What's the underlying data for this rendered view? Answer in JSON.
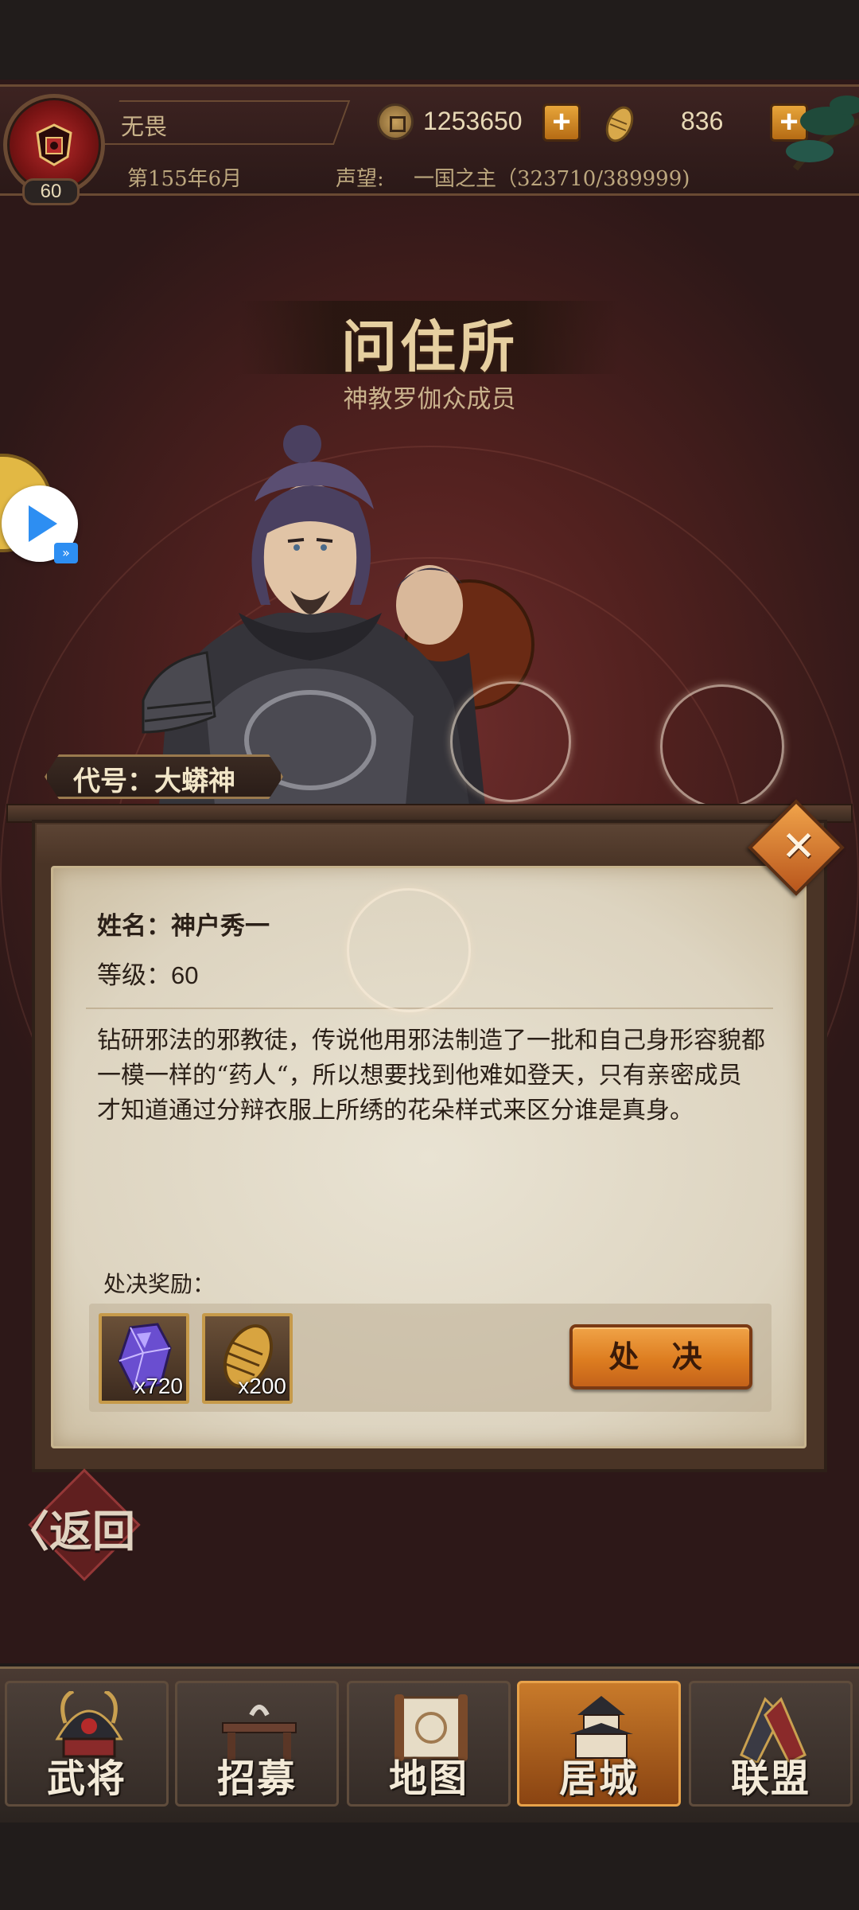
{
  "header": {
    "player_name": "无畏",
    "player_level": "60",
    "coins": "1253650",
    "ingots": "836",
    "date": "第155年6月",
    "prestige_label": "声望:",
    "prestige_value": "一国之主（323710/389999)"
  },
  "page": {
    "title": "问住所",
    "subtitle": "神教罗伽众成员"
  },
  "character": {
    "code_name": "代号：大蟒神",
    "name_label": "姓名：神户秀一",
    "level_label": "等级：",
    "level_value": "60",
    "description": "钻研邪法的邪教徒，传说他用邪法制造了一批和自己身形容貌都一模一样的“药人“，所以想要找到他难如登天，只有亲密成员才知道通过分辩衣服上所绣的花朵样式来区分谁是真身。"
  },
  "rewards": {
    "label": "处决奖励：",
    "items": [
      {
        "icon": "purple-crystal-icon",
        "qty": "x720"
      },
      {
        "icon": "gold-ingot-icon",
        "qty": "x200"
      }
    ],
    "execute_label": "处 决"
  },
  "back_label": "返回",
  "nav": {
    "tabs": [
      {
        "label": "武将",
        "icon": "samurai-helmet-icon",
        "active": false
      },
      {
        "label": "招募",
        "icon": "recruit-sword-icon",
        "active": false
      },
      {
        "label": "地图",
        "icon": "map-scroll-icon",
        "active": false
      },
      {
        "label": "居城",
        "icon": "castle-icon",
        "active": true
      },
      {
        "label": "联盟",
        "icon": "alliance-flags-icon",
        "active": false
      }
    ]
  },
  "colors": {
    "accent_orange": "#dd7d20",
    "background_red": "#52211f",
    "paper": "#e9e3d3",
    "gold_border": "#c69a4a"
  }
}
